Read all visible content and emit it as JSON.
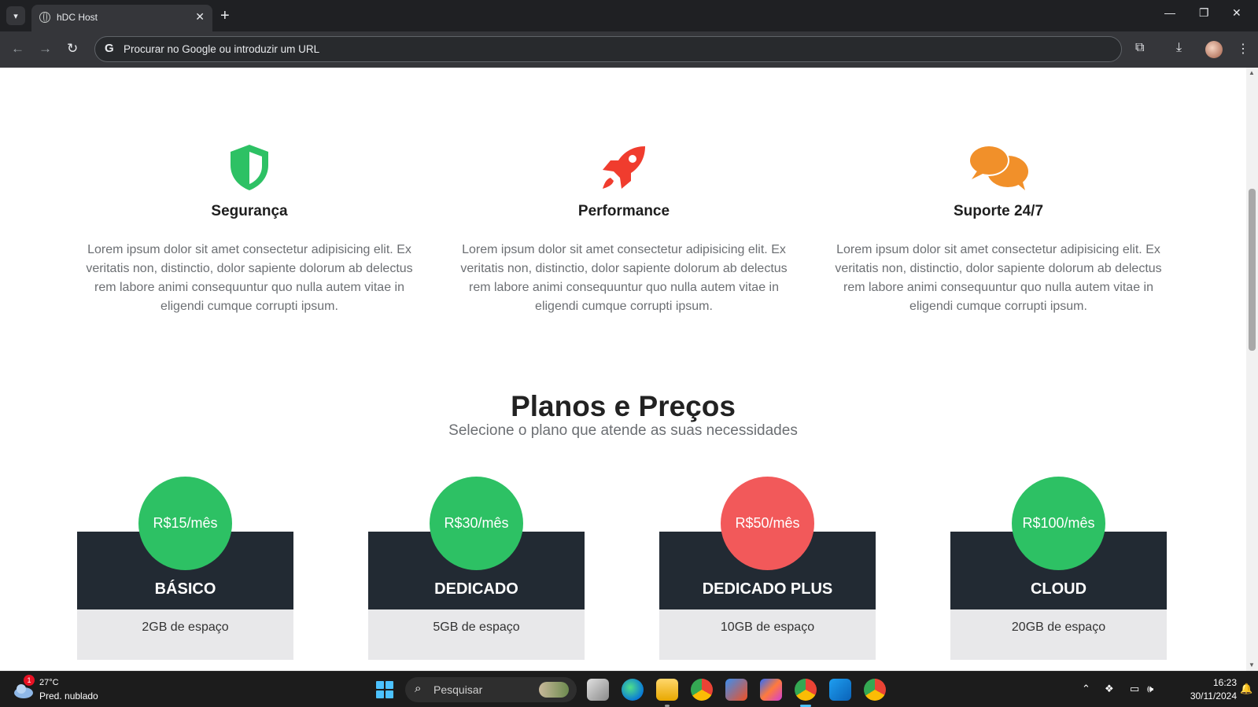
{
  "browser": {
    "tab_title": "hDC Host",
    "omnibox_placeholder": "Procurar no Google ou introduzir um URL",
    "google_letter": "G"
  },
  "features": [
    {
      "icon": "shield-icon",
      "title": "Segurança",
      "text": "Lorem ipsum dolor sit amet consectetur adipisicing elit. Ex veritatis non, distinctio, dolor sapiente dolorum ab delectus rem labore animi consequuntur quo nulla autem vitae in eligendi cumque corrupti ipsum.",
      "color": "#2dc164"
    },
    {
      "icon": "rocket-icon",
      "title": "Performance",
      "text": "Lorem ipsum dolor sit amet consectetur adipisicing elit. Ex veritatis non, distinctio, dolor sapiente dolorum ab delectus rem labore animi consequuntur quo nulla autem vitae in eligendi cumque corrupti ipsum.",
      "color": "#f03c2e"
    },
    {
      "icon": "chat-bubbles-icon",
      "title": "Suporte 24/7",
      "text": "Lorem ipsum dolor sit amet consectetur adipisicing elit. Ex veritatis non, distinctio, dolor sapiente dolorum ab delectus rem labore animi consequuntur quo nulla autem vitae in eligendi cumque corrupti ipsum.",
      "color": "#f1902a"
    }
  ],
  "plans_section": {
    "title": "Planos e Preços",
    "subtitle": "Selecione o plano que atende as suas necessidades"
  },
  "plans": [
    {
      "price": "R$15/mês",
      "name": "BÁSICO",
      "feature": "2GB de espaço",
      "price_color": "#2dc164"
    },
    {
      "price": "R$30/mês",
      "name": "DEDICADO",
      "feature": "5GB de espaço",
      "price_color": "#2dc164"
    },
    {
      "price": "R$50/mês",
      "name": "DEDICADO PLUS",
      "feature": "10GB de espaço",
      "price_color": "#f2595a"
    },
    {
      "price": "R$100/mês",
      "name": "CLOUD",
      "feature": "20GB de espaço",
      "price_color": "#2dc164"
    }
  ],
  "taskbar": {
    "weather_badge": "1",
    "weather_temp": "27°C",
    "weather_desc": "Pred. nublado",
    "search_label": "Pesquisar",
    "time": "16:23",
    "date": "30/11/2024"
  },
  "colors": {
    "accent_green": "#2dc164",
    "accent_red": "#f2595a",
    "plan_header": "#222a33",
    "plan_body": "#e8e8ea"
  }
}
